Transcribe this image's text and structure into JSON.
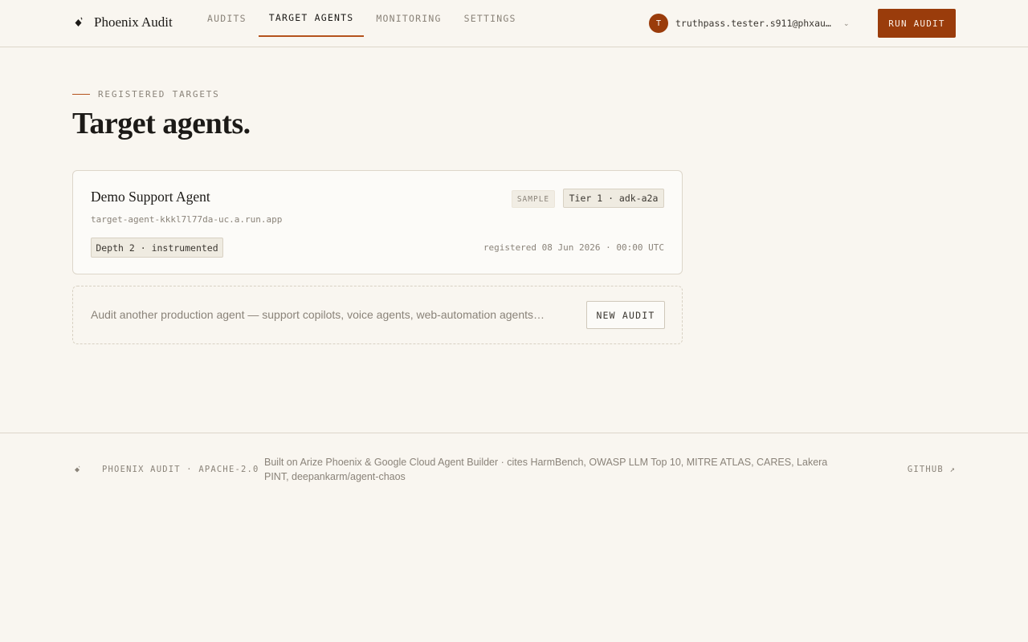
{
  "colors": {
    "accent": "#9a3c0b",
    "background": "#f9f6f0",
    "border": "#ddd6ca"
  },
  "header": {
    "brand_icon": "flame-diamond-icon",
    "brand_name": "Phoenix Audit",
    "nav": [
      {
        "label": "AUDITS",
        "active": false
      },
      {
        "label": "TARGET AGENTS",
        "active": true
      },
      {
        "label": "MONITORING",
        "active": false
      },
      {
        "label": "SETTINGS",
        "active": false
      }
    ],
    "user": {
      "initial": "T",
      "email": "truthpass.tester.s911@phxau…",
      "menu_icon": "caret-down-icon"
    },
    "run_audit_label": "RUN AUDIT"
  },
  "page": {
    "eyebrow": "REGISTERED TARGETS",
    "title": "Target agents."
  },
  "agents": [
    {
      "name": "Demo Support Agent",
      "host": "target-agent-kkkl7l77da-uc.a.run.app",
      "sample_badge": "SAMPLE",
      "tier_badge": "Tier 1 · adk-a2a",
      "depth_badge": "Depth 2 · instrumented",
      "registered": "registered 08 Jun 2026 · 00:00 UTC"
    }
  ],
  "new_audit": {
    "text": "Audit another production agent — support copilots, voice agents, web-automation agents…",
    "button_label": "NEW AUDIT"
  },
  "footer": {
    "brand": "PHOENIX AUDIT · APACHE-2.0",
    "description": "Built on Arize Phoenix & Google Cloud Agent Builder · cites HarmBench, OWASP LLM Top 10, MITRE ATLAS, CARES, Lakera PINT, deepankarm/agent-chaos",
    "github_label": "GITHUB ↗"
  }
}
